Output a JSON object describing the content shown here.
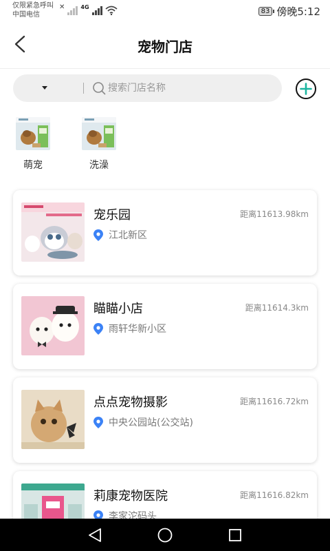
{
  "status_bar": {
    "line1": "仅限紧急呼叫",
    "line2": "中国电信",
    "network": "4G",
    "battery": "83",
    "time": "傍晚5:12"
  },
  "header": {
    "title": "宠物门店"
  },
  "search": {
    "placeholder": "搜索门店名称",
    "value": ""
  },
  "categories": [
    {
      "label": "萌宠",
      "icon": "pet-food-thumbnail"
    },
    {
      "label": "洗澡",
      "icon": "pet-food-thumbnail"
    }
  ],
  "stores": [
    {
      "name": "宠乐园",
      "distance": "距离11613.98km",
      "address": "江北新区"
    },
    {
      "name": "瞄瞄小店",
      "distance": "距离11614.3km",
      "address": "雨轩华新小区"
    },
    {
      "name": "点点宠物摄影",
      "distance": "距离11616.72km",
      "address": "中央公园站(公交站)"
    },
    {
      "name": "莉康宠物医院",
      "distance": "距离11616.82km",
      "address": "李家沱码头"
    }
  ],
  "colors": {
    "accent": "#1bb5a0",
    "pin": "#3b82f6",
    "nav": "#000000"
  }
}
